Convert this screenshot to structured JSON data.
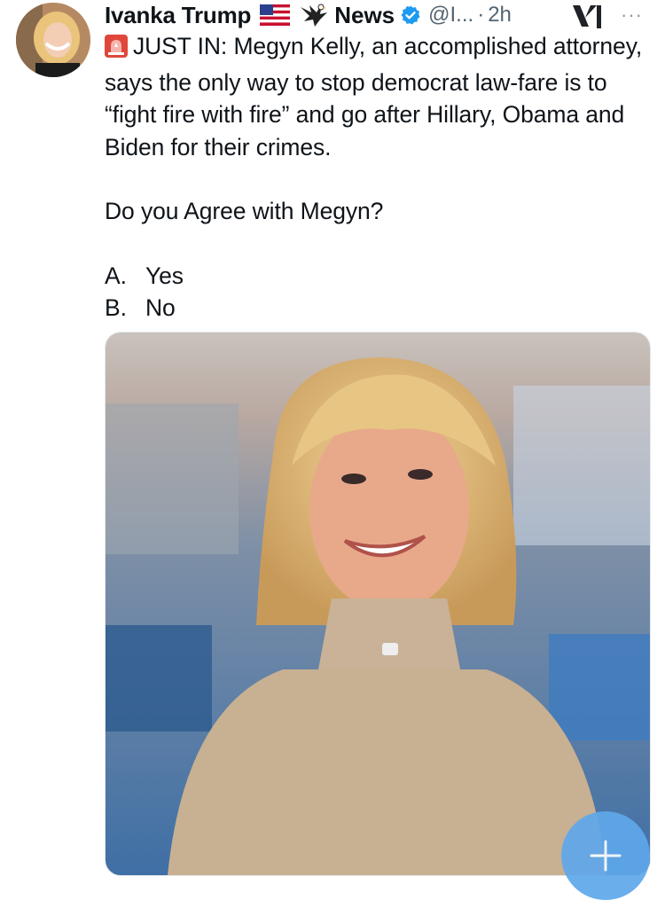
{
  "author": {
    "display_name": "Ivanka Trump",
    "flag_icon": "us-flag-icon",
    "eagle_icon": "eagle-icon",
    "affiliation": "News",
    "handle": "@I...",
    "separator": "·",
    "timestamp": "2h",
    "more_label": "···"
  },
  "tweet": {
    "lines": [
      "JUST IN: Megyn Kelly, an accomplished attorney, says the only way to stop democrat law-fare is to “fight fire with fire” and go after Hillary, Obama and Biden for their crimes.",
      "Do you Agree with Megyn?"
    ],
    "options": [
      {
        "letter": "A.",
        "text": "Yes"
      },
      {
        "letter": "B.",
        "text": "No"
      }
    ]
  },
  "colors": {
    "verified": "#1d9bf0",
    "muted": "#536471",
    "fab": "#5fa8eb"
  },
  "fab": {
    "icon": "plus-icon"
  }
}
